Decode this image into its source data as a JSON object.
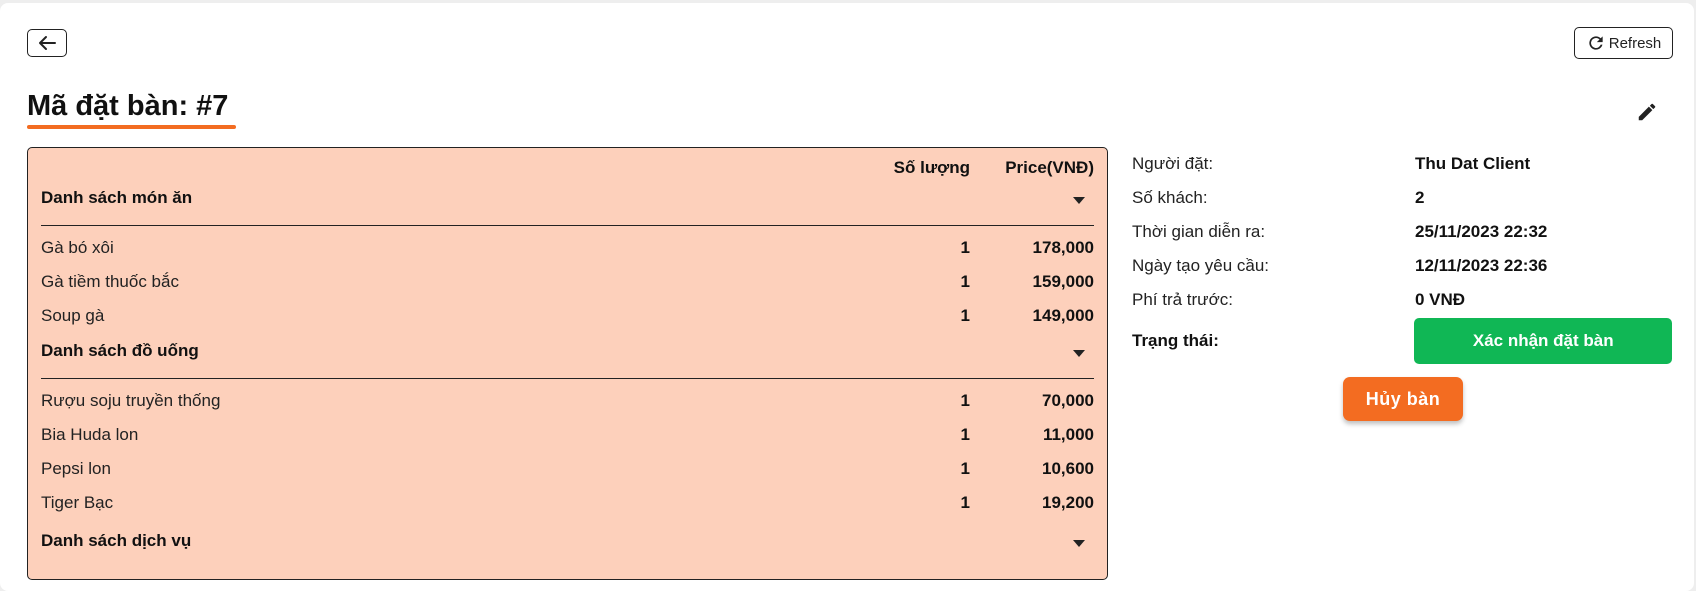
{
  "header": {
    "refresh_label": "Refresh",
    "title": "Mã đặt bàn: #7"
  },
  "order": {
    "qty_header": "Số lượng",
    "price_header": "Price(VNĐ)",
    "food": {
      "title": "Danh sách món ăn",
      "items": [
        {
          "name": "Gà bó xôi",
          "qty": "1",
          "price": "178,000"
        },
        {
          "name": "Gà tiềm thuốc bắc",
          "qty": "1",
          "price": "159,000"
        },
        {
          "name": "Soup gà",
          "qty": "1",
          "price": "149,000"
        }
      ]
    },
    "drinks": {
      "title": "Danh sách đồ uống",
      "items": [
        {
          "name": "Rượu soju truyền thống",
          "qty": "1",
          "price": "70,000"
        },
        {
          "name": "Bia Huda lon",
          "qty": "1",
          "price": "11,000"
        },
        {
          "name": "Pepsi lon",
          "qty": "1",
          "price": "10,600"
        },
        {
          "name": "Tiger Bạc",
          "qty": "1",
          "price": "19,200"
        }
      ]
    },
    "services": {
      "title": "Danh sách dịch vụ"
    }
  },
  "info": {
    "rows": [
      {
        "label": "Người đặt:",
        "value": "Thu Dat Client"
      },
      {
        "label": "Số khách:",
        "value": "2"
      },
      {
        "label": "Thời gian diễn ra:",
        "value": "25/11/2023 22:32"
      },
      {
        "label": "Ngày tạo yêu cầu:",
        "value": "12/11/2023 22:36"
      },
      {
        "label": "Phí trả trước:",
        "value": "0 VNĐ"
      }
    ],
    "status_label": "Trạng thái:",
    "status_button": "Xác nhận đặt bàn",
    "cancel_button": "Hủy bàn"
  },
  "icons": {
    "back": "arrow-left-icon",
    "refresh": "refresh-icon",
    "edit": "pencil-icon",
    "dropdown": "caret-down-icon"
  },
  "colors": {
    "accent": "#f36c21",
    "card_bg": "#fdd0bb",
    "confirm": "#10b755"
  }
}
